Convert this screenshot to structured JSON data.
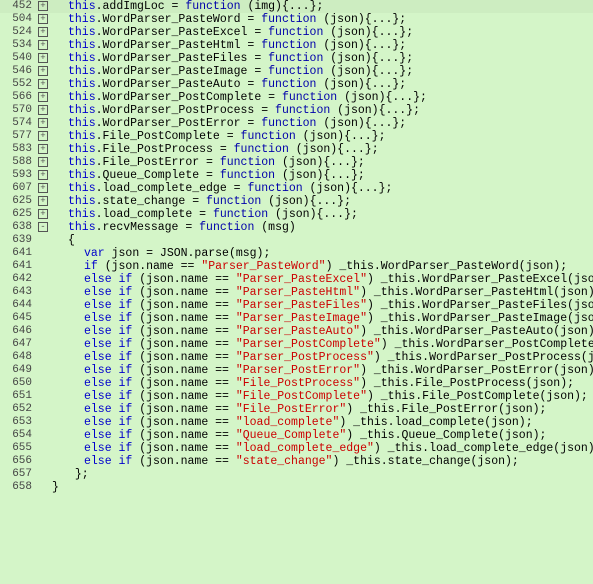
{
  "lines": [
    {
      "num": 452,
      "expand": "+",
      "indent": 1,
      "tokens": [
        {
          "t": "this",
          "c": "kw"
        },
        {
          "t": ".addImgLoc = ",
          "c": ""
        },
        {
          "t": "function",
          "c": "fn"
        },
        {
          "t": " (img)",
          "c": ""
        },
        {
          "t": "{...}",
          "c": "punct"
        },
        {
          "t": ";",
          "c": ""
        }
      ]
    },
    {
      "num": 504,
      "expand": "+",
      "indent": 1,
      "tokens": [
        {
          "t": "this",
          "c": "kw"
        },
        {
          "t": ".WordParser_PasteWord = ",
          "c": ""
        },
        {
          "t": "function",
          "c": "fn"
        },
        {
          "t": " (json)",
          "c": ""
        },
        {
          "t": "{...}",
          "c": "punct"
        },
        {
          "t": ";",
          "c": ""
        }
      ]
    },
    {
      "num": 524,
      "expand": "+",
      "indent": 1,
      "tokens": [
        {
          "t": "this",
          "c": "kw"
        },
        {
          "t": ".WordParser_PasteExcel = ",
          "c": ""
        },
        {
          "t": "function",
          "c": "fn"
        },
        {
          "t": " (json)",
          "c": ""
        },
        {
          "t": "{...}",
          "c": "punct"
        },
        {
          "t": ";",
          "c": ""
        }
      ]
    },
    {
      "num": 534,
      "expand": "+",
      "indent": 1,
      "tokens": [
        {
          "t": "this",
          "c": "kw"
        },
        {
          "t": ".WordParser_PasteHtml = ",
          "c": ""
        },
        {
          "t": "function",
          "c": "fn"
        },
        {
          "t": " (json)",
          "c": ""
        },
        {
          "t": "{...}",
          "c": "punct"
        },
        {
          "t": ";",
          "c": ""
        }
      ]
    },
    {
      "num": 540,
      "expand": "+",
      "indent": 1,
      "tokens": [
        {
          "t": "this",
          "c": "kw"
        },
        {
          "t": ".WordParser_PasteFiles = ",
          "c": ""
        },
        {
          "t": "function",
          "c": "fn"
        },
        {
          "t": " (json)",
          "c": ""
        },
        {
          "t": "{...}",
          "c": "punct"
        },
        {
          "t": ";",
          "c": ""
        }
      ]
    },
    {
      "num": 546,
      "expand": "+",
      "indent": 1,
      "tokens": [
        {
          "t": "this",
          "c": "kw"
        },
        {
          "t": ".WordParser_PasteImage = ",
          "c": ""
        },
        {
          "t": "function",
          "c": "fn"
        },
        {
          "t": " (json)",
          "c": ""
        },
        {
          "t": "{...}",
          "c": "punct"
        },
        {
          "t": ";",
          "c": ""
        }
      ]
    },
    {
      "num": 552,
      "expand": "+",
      "indent": 1,
      "tokens": [
        {
          "t": "this",
          "c": "kw"
        },
        {
          "t": ".WordParser_PasteAuto = ",
          "c": ""
        },
        {
          "t": "function",
          "c": "fn"
        },
        {
          "t": " (json)",
          "c": ""
        },
        {
          "t": "{...}",
          "c": "punct"
        },
        {
          "t": ";",
          "c": ""
        }
      ]
    },
    {
      "num": 566,
      "expand": "+",
      "indent": 1,
      "tokens": [
        {
          "t": "this",
          "c": "kw"
        },
        {
          "t": ".WordParser_PostComplete = ",
          "c": ""
        },
        {
          "t": "function",
          "c": "fn"
        },
        {
          "t": " (json)",
          "c": ""
        },
        {
          "t": "{...}",
          "c": "punct"
        },
        {
          "t": ";",
          "c": ""
        }
      ]
    },
    {
      "num": 570,
      "expand": "+",
      "indent": 1,
      "tokens": [
        {
          "t": "this",
          "c": "kw"
        },
        {
          "t": ".WordParser_PostProcess = ",
          "c": ""
        },
        {
          "t": "function",
          "c": "fn"
        },
        {
          "t": " (json)",
          "c": ""
        },
        {
          "t": "{...}",
          "c": "punct"
        },
        {
          "t": ";",
          "c": ""
        }
      ]
    },
    {
      "num": 574,
      "expand": "+",
      "indent": 1,
      "tokens": [
        {
          "t": "this",
          "c": "kw"
        },
        {
          "t": ".WordParser_PostError = ",
          "c": ""
        },
        {
          "t": "function",
          "c": "fn"
        },
        {
          "t": " (json)",
          "c": ""
        },
        {
          "t": "{...}",
          "c": "punct"
        },
        {
          "t": ";",
          "c": ""
        }
      ]
    },
    {
      "num": 577,
      "expand": "+",
      "indent": 1,
      "tokens": [
        {
          "t": "this",
          "c": "kw"
        },
        {
          "t": ".File_PostComplete = ",
          "c": ""
        },
        {
          "t": "function",
          "c": "fn"
        },
        {
          "t": " (json)",
          "c": ""
        },
        {
          "t": "{...}",
          "c": "punct"
        },
        {
          "t": ";",
          "c": ""
        }
      ]
    },
    {
      "num": 583,
      "expand": "+",
      "indent": 1,
      "tokens": [
        {
          "t": "this",
          "c": "kw"
        },
        {
          "t": ".File_PostProcess = ",
          "c": ""
        },
        {
          "t": "function",
          "c": "fn"
        },
        {
          "t": " (json)",
          "c": ""
        },
        {
          "t": "{...}",
          "c": "punct"
        },
        {
          "t": ";",
          "c": ""
        }
      ]
    },
    {
      "num": 588,
      "expand": "+",
      "indent": 1,
      "tokens": [
        {
          "t": "this",
          "c": "kw"
        },
        {
          "t": ".File_PostError = ",
          "c": ""
        },
        {
          "t": "function",
          "c": "fn"
        },
        {
          "t": " (json)",
          "c": ""
        },
        {
          "t": "{...}",
          "c": "punct"
        },
        {
          "t": ";",
          "c": ""
        }
      ]
    },
    {
      "num": 593,
      "expand": "+",
      "indent": 1,
      "tokens": [
        {
          "t": "this",
          "c": "kw"
        },
        {
          "t": ".Queue_Complete = ",
          "c": ""
        },
        {
          "t": "function",
          "c": "fn"
        },
        {
          "t": " (json)",
          "c": ""
        },
        {
          "t": "{...}",
          "c": "punct"
        },
        {
          "t": ";",
          "c": ""
        }
      ]
    },
    {
      "num": 607,
      "expand": "+",
      "indent": 1,
      "tokens": [
        {
          "t": "this",
          "c": "kw"
        },
        {
          "t": ".load_complete_edge = ",
          "c": ""
        },
        {
          "t": "function",
          "c": "fn"
        },
        {
          "t": " (json)",
          "c": ""
        },
        {
          "t": "{...}",
          "c": "punct"
        },
        {
          "t": ";",
          "c": ""
        }
      ]
    },
    {
      "num": 625,
      "expand": "+",
      "indent": 1,
      "tokens": [
        {
          "t": "this",
          "c": "kw"
        },
        {
          "t": ".state_change = ",
          "c": ""
        },
        {
          "t": "function",
          "c": "fn"
        },
        {
          "t": " (json)",
          "c": ""
        },
        {
          "t": "{...}",
          "c": "punct"
        },
        {
          "t": ";",
          "c": ""
        }
      ]
    },
    {
      "num": 625,
      "expand": "+",
      "indent": 1,
      "tokens": [
        {
          "t": "this",
          "c": "kw"
        },
        {
          "t": ".load_complete = ",
          "c": ""
        },
        {
          "t": "function",
          "c": "fn"
        },
        {
          "t": " (json)",
          "c": ""
        },
        {
          "t": "{...}",
          "c": "punct"
        },
        {
          "t": ";",
          "c": ""
        }
      ]
    },
    {
      "num": 638,
      "expand": "-",
      "indent": 1,
      "tokens": [
        {
          "t": "this",
          "c": "kw"
        },
        {
          "t": ".recvMessage = ",
          "c": ""
        },
        {
          "t": "function",
          "c": "fn"
        },
        {
          "t": " (msg)",
          "c": ""
        }
      ]
    },
    {
      "num": 639,
      "expand": "",
      "indent": 1,
      "tokens": [
        {
          "t": "{",
          "c": "punct"
        }
      ]
    },
    {
      "num": 641,
      "expand": "",
      "indent": 2,
      "tokens": [
        {
          "t": "var",
          "c": "kw"
        },
        {
          "t": " json = JSON.parse(msg);",
          "c": ""
        }
      ]
    },
    {
      "num": 641,
      "expand": "",
      "indent": 2,
      "tokens": [
        {
          "t": "if",
          "c": "kw"
        },
        {
          "t": "      (json.name == ",
          "c": ""
        },
        {
          "t": "\"Parser_PasteWord\"",
          "c": "str"
        },
        {
          "t": ") _this.WordParser_PasteWord(json);",
          "c": ""
        }
      ]
    },
    {
      "num": 642,
      "expand": "",
      "indent": 2,
      "tokens": [
        {
          "t": "else if",
          "c": "kw"
        },
        {
          "t": " (json.name == ",
          "c": ""
        },
        {
          "t": "\"Parser_PasteExcel\"",
          "c": "str"
        },
        {
          "t": ") _this.WordParser_PasteExcel(json);",
          "c": ""
        }
      ]
    },
    {
      "num": 643,
      "expand": "",
      "indent": 2,
      "tokens": [
        {
          "t": "else if",
          "c": "kw"
        },
        {
          "t": " (json.name == ",
          "c": ""
        },
        {
          "t": "\"Parser_PasteHtml\"",
          "c": "str"
        },
        {
          "t": ") _this.WordParser_PasteHtml(json);",
          "c": ""
        }
      ]
    },
    {
      "num": 644,
      "expand": "",
      "indent": 2,
      "tokens": [
        {
          "t": "else if",
          "c": "kw"
        },
        {
          "t": " (json.name == ",
          "c": ""
        },
        {
          "t": "\"Parser_PasteFiles\"",
          "c": "str"
        },
        {
          "t": ") _this.WordParser_PasteFiles(json);",
          "c": ""
        }
      ]
    },
    {
      "num": 645,
      "expand": "",
      "indent": 2,
      "tokens": [
        {
          "t": "else if",
          "c": "kw"
        },
        {
          "t": " (json.name == ",
          "c": ""
        },
        {
          "t": "\"Parser_PasteImage\"",
          "c": "str"
        },
        {
          "t": ") _this.WordParser_PasteImage(json);",
          "c": ""
        }
      ]
    },
    {
      "num": 646,
      "expand": "",
      "indent": 2,
      "tokens": [
        {
          "t": "else if",
          "c": "kw"
        },
        {
          "t": " (json.name == ",
          "c": ""
        },
        {
          "t": "\"Parser_PasteAuto\"",
          "c": "str"
        },
        {
          "t": ") _this.WordParser_PasteAuto(json);",
          "c": ""
        }
      ]
    },
    {
      "num": 647,
      "expand": "",
      "indent": 2,
      "tokens": [
        {
          "t": "else if",
          "c": "kw"
        },
        {
          "t": " (json.name == ",
          "c": ""
        },
        {
          "t": "\"Parser_PostComplete\"",
          "c": "str"
        },
        {
          "t": ") _this.WordParser_PostComplete(json);",
          "c": ""
        }
      ]
    },
    {
      "num": 648,
      "expand": "",
      "indent": 2,
      "tokens": [
        {
          "t": "else if",
          "c": "kw"
        },
        {
          "t": " (json.name == ",
          "c": ""
        },
        {
          "t": "\"Parser_PostProcess\"",
          "c": "str"
        },
        {
          "t": ") _this.WordParser_PostProcess(json);",
          "c": ""
        }
      ]
    },
    {
      "num": 649,
      "expand": "",
      "indent": 2,
      "tokens": [
        {
          "t": "else if",
          "c": "kw"
        },
        {
          "t": " (json.name == ",
          "c": ""
        },
        {
          "t": "\"Parser_PostError\"",
          "c": "str"
        },
        {
          "t": ") _this.WordParser_PostError(json);",
          "c": ""
        }
      ]
    },
    {
      "num": 650,
      "expand": "",
      "indent": 2,
      "tokens": [
        {
          "t": "else if",
          "c": "kw"
        },
        {
          "t": " (json.name == ",
          "c": ""
        },
        {
          "t": "\"File_PostProcess\"",
          "c": "str"
        },
        {
          "t": ") _this.File_PostProcess(json);",
          "c": ""
        }
      ]
    },
    {
      "num": 651,
      "expand": "",
      "indent": 2,
      "tokens": [
        {
          "t": "else if",
          "c": "kw"
        },
        {
          "t": " (json.name == ",
          "c": ""
        },
        {
          "t": "\"File_PostComplete\"",
          "c": "str"
        },
        {
          "t": ") _this.File_PostComplete(json);",
          "c": ""
        }
      ]
    },
    {
      "num": 652,
      "expand": "",
      "indent": 2,
      "tokens": [
        {
          "t": "else if",
          "c": "kw"
        },
        {
          "t": " (json.name == ",
          "c": ""
        },
        {
          "t": "\"File_PostError\"",
          "c": "str"
        },
        {
          "t": ") _this.File_PostError(json);",
          "c": ""
        }
      ]
    },
    {
      "num": 653,
      "expand": "",
      "indent": 2,
      "tokens": [
        {
          "t": "else if",
          "c": "kw"
        },
        {
          "t": " (json.name == ",
          "c": ""
        },
        {
          "t": "\"load_complete\"",
          "c": "str"
        },
        {
          "t": ") _this.load_complete(json);",
          "c": ""
        }
      ]
    },
    {
      "num": 654,
      "expand": "",
      "indent": 2,
      "tokens": [
        {
          "t": "else if",
          "c": "kw"
        },
        {
          "t": " (json.name == ",
          "c": ""
        },
        {
          "t": "\"Queue_Complete\"",
          "c": "str"
        },
        {
          "t": ") _this.Queue_Complete(json);",
          "c": ""
        }
      ]
    },
    {
      "num": 655,
      "expand": "",
      "indent": 2,
      "tokens": [
        {
          "t": "else if",
          "c": "kw"
        },
        {
          "t": " (json.name == ",
          "c": ""
        },
        {
          "t": "\"load_complete_edge\"",
          "c": "str"
        },
        {
          "t": ") _this.load_complete_edge(json);",
          "c": ""
        }
      ]
    },
    {
      "num": 656,
      "expand": "",
      "indent": 2,
      "tokens": [
        {
          "t": "else if",
          "c": "kw"
        },
        {
          "t": " (json.name == ",
          "c": ""
        },
        {
          "t": "\"state_change\"",
          "c": "str"
        },
        {
          "t": ") _this.state_change(json);",
          "c": ""
        }
      ]
    },
    {
      "num": 657,
      "expand": "",
      "indent": 1,
      "tokens": [
        {
          "t": "    };",
          "c": "punct"
        }
      ]
    },
    {
      "num": 658,
      "expand": "",
      "indent": 0,
      "tokens": [
        {
          "t": "}",
          "c": "punct"
        }
      ]
    }
  ]
}
